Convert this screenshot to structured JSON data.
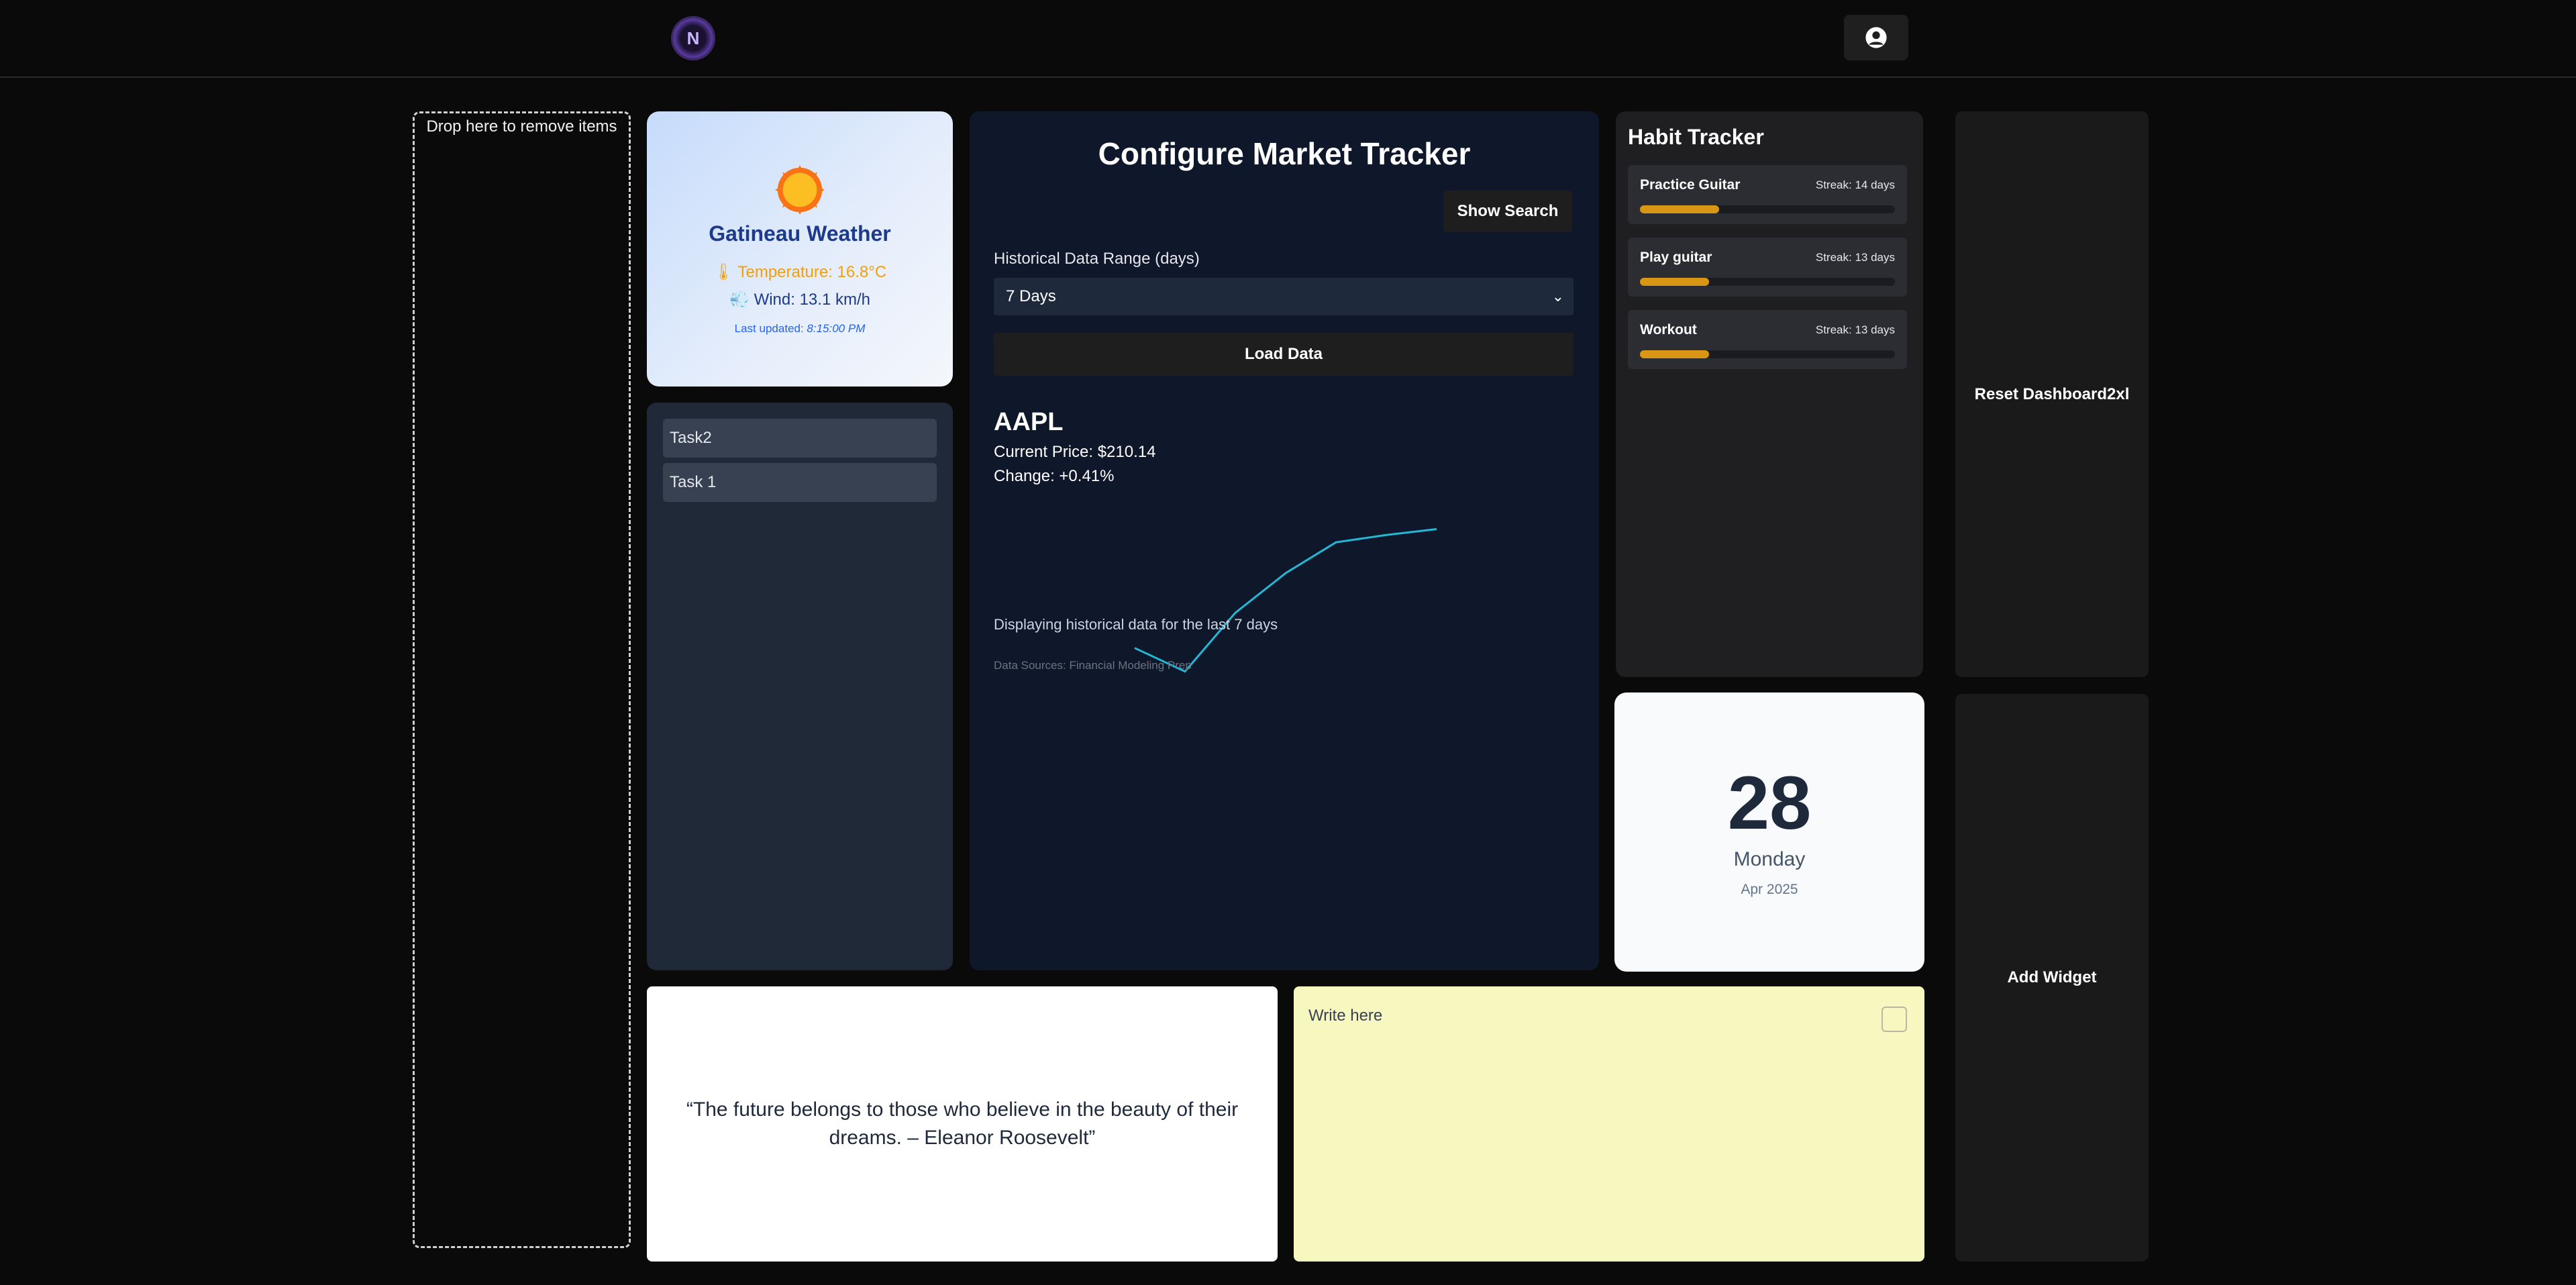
{
  "header": {
    "logo_text": "N",
    "profile_icon": "user-circle-icon"
  },
  "dropzone": {
    "label": "Drop here to remove items"
  },
  "weather": {
    "city": "Gatineau Weather",
    "temperature": "🌡 Temperature: 16.8°C",
    "wind": "💨 Wind: 13.1 km/h",
    "updated_label": "Last updated: ",
    "updated_time": "8:15:00 PM",
    "icon": "sun-icon"
  },
  "tasks": {
    "items": [
      {
        "label": "Task2"
      },
      {
        "label": "Task 1"
      }
    ]
  },
  "market": {
    "title": "Configure Market Tracker",
    "show_search": "Show Search",
    "range_label": "Historical Data Range (days)",
    "range_value": "7 Days",
    "load_data": "Load Data",
    "ticker": "AAPL",
    "price": "Current Price: $210.14",
    "change": "Change: +0.41%",
    "history_note": "Displaying historical data for the last 7 days",
    "data_sources": "Data Sources: Financial Modeling Prep"
  },
  "chart_data": {
    "type": "line",
    "x": [
      1,
      2,
      3,
      4,
      5,
      6,
      7
    ],
    "series": [
      {
        "values": [
          203.5,
          201.9,
          205.9,
          208.6,
          210.7,
          211.2,
          211.6
        ]
      }
    ],
    "ylim": [
      198,
      214
    ],
    "grid": false,
    "color": "#22b8d6"
  },
  "habits": {
    "title": "Habit Tracker",
    "items": [
      {
        "name": "Practice Guitar",
        "streak": "Streak: 14 days",
        "progress": 0.31
      },
      {
        "name": "Play guitar",
        "streak": "Streak: 13 days",
        "progress": 0.27
      },
      {
        "name": "Workout",
        "streak": "Streak: 13 days",
        "progress": 0.27
      }
    ],
    "accent": "#d89614"
  },
  "calendar": {
    "day": "28",
    "weekday": "Monday",
    "month": "Apr 2025"
  },
  "controls": {
    "reset": "Reset Dashboard2xl",
    "add_widget": "Add Widget"
  },
  "quote": {
    "text": "“The future belongs to those who believe in the beauty of their dreams. – Eleanor Roosevelt”"
  },
  "note": {
    "placeholder": "Write here"
  }
}
